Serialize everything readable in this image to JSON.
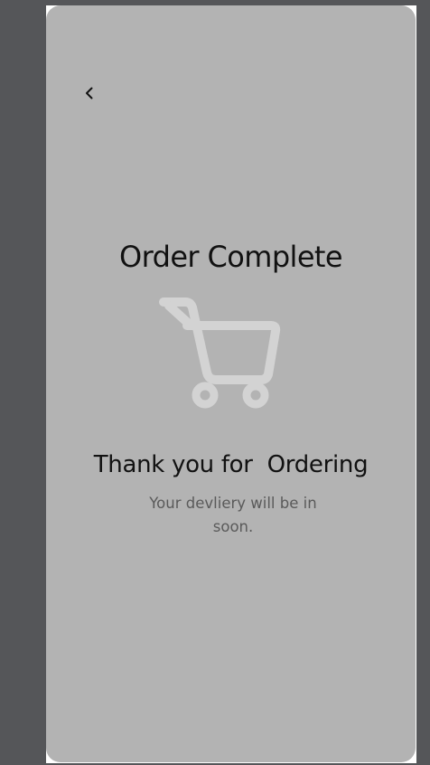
{
  "screen": {
    "title": "Order Complete",
    "heading": "Thank you for  Ordering",
    "message": "Your devliery will be in soon."
  },
  "icons": {
    "back": "chevron-left-icon",
    "cart": "shopping-cart-icon"
  },
  "colors": {
    "viewer_background": "#555659",
    "screen_background": "#b3b3b3",
    "cart_icon": "#d3d3d3",
    "title_text": "#111111",
    "message_text": "#5a5a5a"
  }
}
